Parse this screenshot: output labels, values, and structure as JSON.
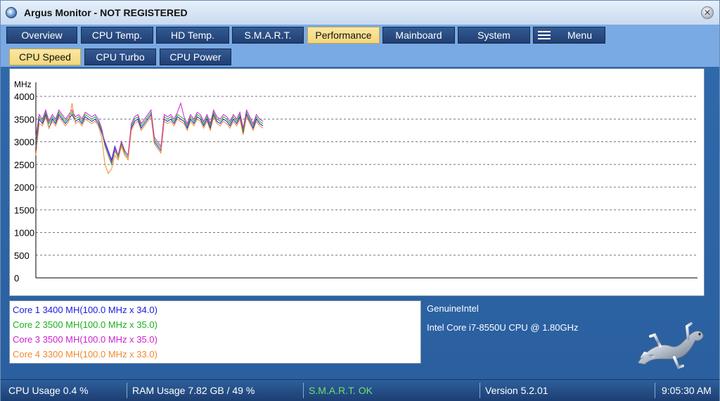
{
  "window": {
    "title": "Argus Monitor - NOT REGISTERED"
  },
  "tabs": {
    "main": [
      {
        "label": "Overview"
      },
      {
        "label": "CPU Temp."
      },
      {
        "label": "HD Temp."
      },
      {
        "label": "S.M.A.R.T."
      },
      {
        "label": "Performance"
      },
      {
        "label": "Mainboard"
      },
      {
        "label": "System"
      },
      {
        "label": "Menu"
      }
    ],
    "sub": [
      {
        "label": "CPU Speed"
      },
      {
        "label": "CPU Turbo"
      },
      {
        "label": "CPU Power"
      }
    ]
  },
  "chart_data": {
    "type": "line",
    "ylabel": "MHz",
    "ylim": [
      0,
      4000
    ],
    "yticks": [
      "4000",
      "3500",
      "3000",
      "2500",
      "2000",
      "1500",
      "1000",
      "500",
      "0"
    ],
    "grid": "horizontal-dashed",
    "series": [
      {
        "color": "#1a1adc",
        "values": [
          2900,
          3500,
          3400,
          3600,
          3300,
          3500,
          3400,
          3600,
          3500,
          3400,
          3500,
          3600,
          3450,
          3500,
          3400,
          3550,
          3500,
          3450,
          3500,
          3400,
          3200,
          3000,
          2800,
          2600,
          2900,
          2700,
          3000,
          2800,
          2700,
          3300,
          3450,
          3500,
          3300,
          3400,
          3500,
          3600,
          3000,
          2900,
          2800,
          3500,
          3450,
          3500,
          3400,
          3550,
          3500,
          3450,
          3300,
          3500,
          3400,
          3550,
          3500,
          3350,
          3500,
          3300,
          3600,
          3450,
          3400,
          3500,
          3450,
          3350,
          3500,
          3400,
          3550,
          3200,
          3600,
          3450,
          3300,
          3500,
          3400,
          3350
        ]
      },
      {
        "color": "#1ab01a",
        "values": [
          3000,
          3550,
          3450,
          3650,
          3400,
          3550,
          3450,
          3650,
          3550,
          3450,
          3550,
          3650,
          3500,
          3550,
          3450,
          3600,
          3550,
          3500,
          3550,
          3450,
          3250,
          2900,
          2700,
          2500,
          2800,
          2650,
          2950,
          2750,
          2650,
          3350,
          3500,
          3550,
          3350,
          3450,
          3550,
          3650,
          3050,
          2950,
          2850,
          3550,
          3500,
          3550,
          3450,
          3600,
          3550,
          3500,
          3350,
          3550,
          3450,
          3600,
          3550,
          3400,
          3550,
          3350,
          3650,
          3500,
          3450,
          3550,
          3500,
          3400,
          3550,
          3450,
          3600,
          3250,
          3650,
          3500,
          3350,
          3550,
          3450,
          3400
        ]
      },
      {
        "color": "#d020d0",
        "values": [
          3100,
          3600,
          3500,
          3700,
          3450,
          3600,
          3500,
          3700,
          3600,
          3500,
          3600,
          3700,
          3550,
          3600,
          3500,
          3650,
          3600,
          3550,
          3600,
          3500,
          3300,
          2950,
          2750,
          2550,
          2850,
          2700,
          3000,
          2800,
          2700,
          3400,
          3550,
          3600,
          3400,
          3500,
          3600,
          3700,
          3100,
          3000,
          2900,
          3600,
          3550,
          3600,
          3500,
          3650,
          3850,
          3550,
          3400,
          3600,
          3500,
          3650,
          3600,
          3450,
          3600,
          3400,
          3700,
          3550,
          3500,
          3600,
          3550,
          3450,
          3600,
          3500,
          3650,
          3300,
          3700,
          3550,
          3400,
          3600,
          3500,
          3450
        ]
      },
      {
        "color": "#f08a30",
        "values": [
          2700,
          3400,
          3350,
          3550,
          3300,
          3450,
          3350,
          3550,
          3450,
          3350,
          3450,
          3850,
          3400,
          3450,
          3350,
          3500,
          3450,
          3400,
          3450,
          3350,
          3100,
          2500,
          2300,
          2400,
          2700,
          2600,
          2900,
          2700,
          2600,
          3250,
          3400,
          3450,
          3250,
          3350,
          3450,
          3550,
          2950,
          2850,
          2750,
          3450,
          3400,
          3450,
          3350,
          3500,
          3450,
          3400,
          3250,
          3450,
          3350,
          3500,
          3450,
          3300,
          3450,
          3250,
          3550,
          3400,
          3350,
          3450,
          3400,
          3300,
          3450,
          3350,
          3500,
          3150,
          3550,
          3400,
          3250,
          3450,
          3350,
          3300
        ]
      }
    ]
  },
  "cores": [
    {
      "label": "Core 1 3400 MH(100.0 MHz x 34.0)",
      "color": "#1a1adc"
    },
    {
      "label": "Core 2 3500 MH(100.0 MHz x 35.0)",
      "color": "#1ab01a"
    },
    {
      "label": "Core 3 3500 MH(100.0 MHz x 35.0)",
      "color": "#d020d0"
    },
    {
      "label": "Core 4 3300 MH(100.0 MHz x 33.0)",
      "color": "#f08a30"
    }
  ],
  "cpu": {
    "vendor": "GenuineIntel",
    "model": "Intel Core i7-8550U CPU @ 1.80GHz"
  },
  "status": {
    "cpu_usage": "CPU Usage 0.4 %",
    "ram_usage": "RAM Usage 7.82 GB / 49 %",
    "smart": "S.M.A.R.T. OK",
    "version": "Version 5.2.01",
    "time": "9:05:30 AM"
  }
}
